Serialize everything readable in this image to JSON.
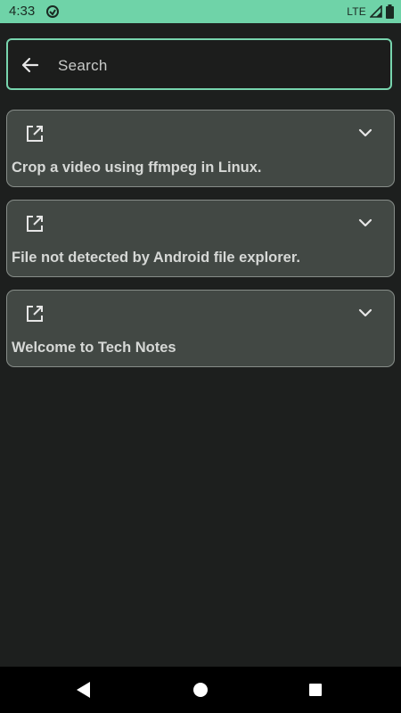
{
  "status_bar": {
    "time": "4:33",
    "network": "LTE",
    "app_icon": "sync-icon",
    "signal_icon": "signal-icon",
    "battery_icon": "battery-icon",
    "background_color": "#6fd3a8"
  },
  "search": {
    "placeholder": "Search",
    "back_icon": "arrow-left-icon",
    "border_color": "#78d5ae"
  },
  "notes": [
    {
      "title": "Crop a video using ffmpeg in Linux.",
      "open_icon": "open-in-new-icon",
      "expand_icon": "chevron-down-icon"
    },
    {
      "title": "File not detected by Android file explorer.",
      "open_icon": "open-in-new-icon",
      "expand_icon": "chevron-down-icon"
    },
    {
      "title": "Welcome to Tech Notes",
      "open_icon": "open-in-new-icon",
      "expand_icon": "chevron-down-icon"
    }
  ],
  "nav_bar": {
    "back_icon": "triangle-back-icon",
    "home_icon": "circle-home-icon",
    "recents_icon": "square-recents-icon"
  }
}
